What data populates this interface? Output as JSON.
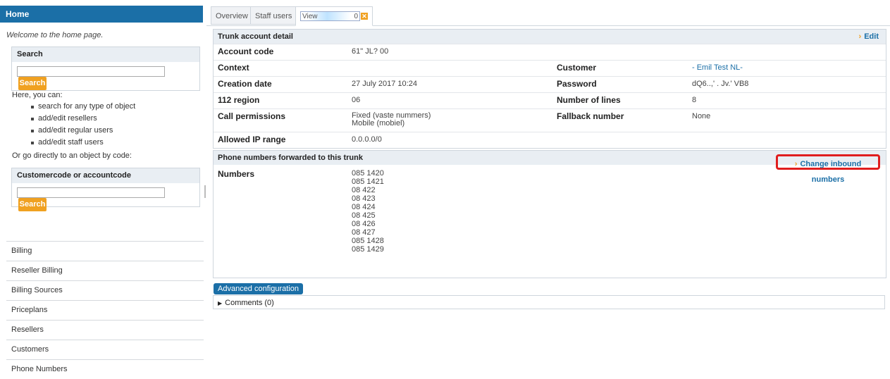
{
  "sidebar": {
    "home_title": "Home",
    "welcome": "Welcome to the home page.",
    "search_panel": {
      "title": "Search",
      "input_value": "",
      "button": "Search"
    },
    "here_intro": "Here, you can:",
    "capabilities": [
      "search for any type of object",
      "add/edit resellers",
      "add/edit regular users",
      "add/edit staff users"
    ],
    "direct_intro": "Or go directly to an object by code:",
    "code_panel": {
      "title": "Customercode or accountcode",
      "input_value": "",
      "button": "Search"
    },
    "nav_items": [
      "Billing",
      "Reseller Billing",
      "Billing Sources",
      "Priceplans",
      "Resellers",
      "Customers",
      "Phone Numbers"
    ]
  },
  "tabs": {
    "overview": "Overview",
    "staff_users": "Staff users",
    "view": "View",
    "view_suffix": "0",
    "close_glyph": "✕"
  },
  "trunk": {
    "title": "Trunk account detail",
    "edit_label": "Edit",
    "account_code_label": "Account code",
    "account_code_value": "61\" JL? 00",
    "context_label": "Context",
    "context_value": "",
    "customer_label": "Customer",
    "customer_value": "- Emil Test NL-",
    "creation_label": "Creation date",
    "creation_value": "27 July 2017 10:24",
    "password_label": "Password",
    "password_value": "dQ6..,' . Jv.' VB8",
    "region_label": "112 region",
    "region_value": "06",
    "lines_label": "Number of lines",
    "lines_value": "8",
    "permissions_label": "Call permissions",
    "permissions_value_1": "Fixed (vaste nummers)",
    "permissions_value_2": "Mobile (mobiel)",
    "fallback_label": "Fallback number",
    "fallback_value": "None",
    "ip_label": "Allowed IP range",
    "ip_value": "0.0.0.0/0"
  },
  "forwarded": {
    "title": "Phone numbers forwarded to this trunk",
    "change_label": "Change inbound numbers",
    "numbers_label": "Numbers",
    "numbers": [
      "085 1420",
      "085 1421",
      "08 422",
      "08 423",
      "08 424",
      "08 425",
      "08 426",
      "08 427",
      "085 1428",
      "085 1429"
    ]
  },
  "advanced_button": "Advanced configuration",
  "comments_label": "Comments (0)",
  "comments_glyph": "▶",
  "colors": {
    "accent": "#1b6fa7",
    "button_orange": "#f0a121",
    "highlight_red": "#e01e1e"
  }
}
